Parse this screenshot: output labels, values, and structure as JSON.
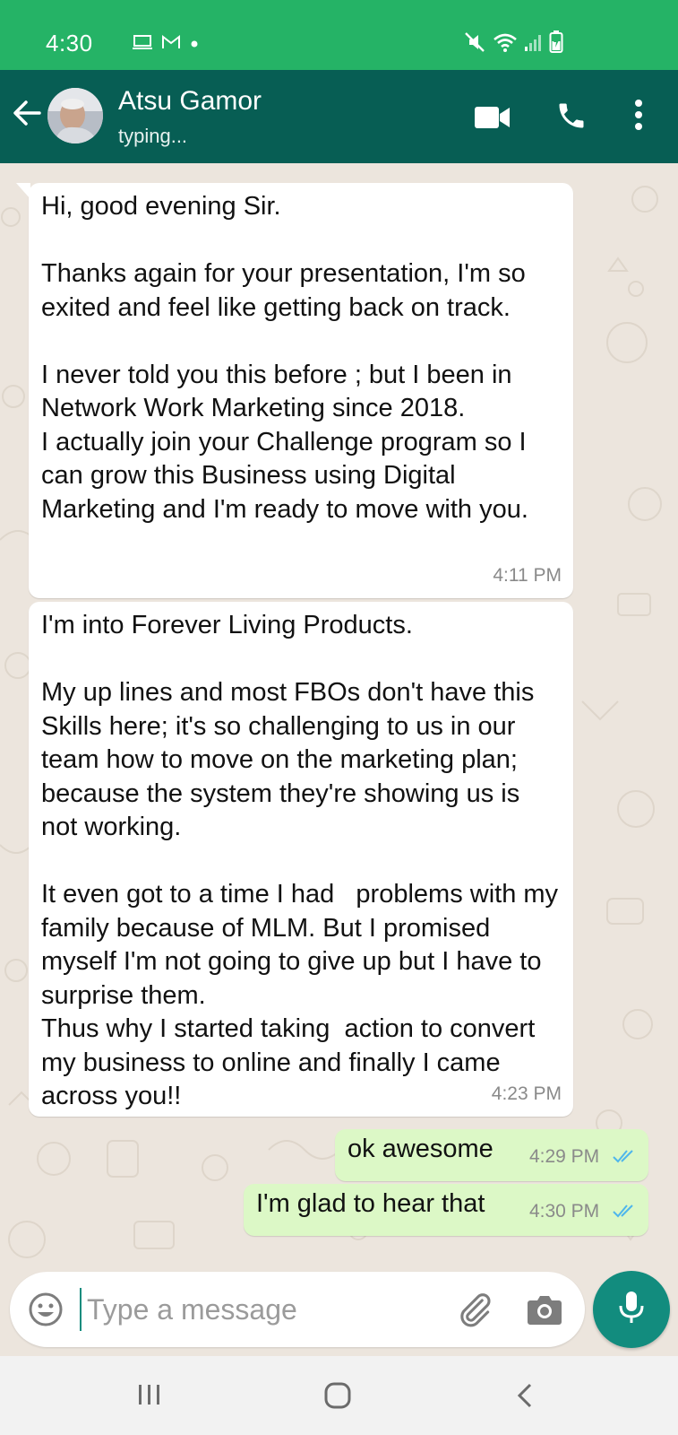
{
  "status_bar": {
    "time": "4:30",
    "icons_left": [
      "screen-icon",
      "gmail-icon",
      "dot-icon"
    ],
    "icons_right": [
      "mute-icon",
      "wifi-icon",
      "signal-icon",
      "battery-icon"
    ],
    "background_color": "#25b366"
  },
  "header": {
    "contact_name": "Atsu Gamor",
    "contact_status": "typing...",
    "background_color": "#075e54",
    "actions": [
      "video-call-icon",
      "phone-icon",
      "more-vert-icon"
    ]
  },
  "messages": [
    {
      "direction": "incoming",
      "text": "Hi, good evening Sir.\n\nThanks again for your presentation, I'm so exited and feel like getting back on track.\n\nI never told you this before ; but I been in Network Work Marketing since 2018.\nI actually join your Challenge program so I can grow this Business using Digital Marketing and I'm ready to move with you.",
      "time": "4:11 PM"
    },
    {
      "direction": "incoming",
      "text": "I'm into Forever Living Products.\n\nMy up lines and most FBOs don't have this Skills here; it's so challenging to us in our team how to move on the marketing plan; because the system they're showing us is not working.\n\nIt even got to a time I had   problems with my family because of MLM. But I promised myself I'm not going to give up but I have to surprise them.\nThus why I started taking  action to convert my business to online and finally I came across you!!",
      "time": "4:23 PM"
    },
    {
      "direction": "outgoing",
      "text": "ok awesome",
      "time": "4:29 PM",
      "status": "read"
    },
    {
      "direction": "outgoing",
      "text": "I'm glad to hear that",
      "time": "4:30 PM",
      "status": "read"
    }
  ],
  "composer": {
    "placeholder": "Type a message",
    "value": "",
    "icons": [
      "emoji-icon",
      "attach-icon",
      "camera-icon",
      "mic-icon"
    ],
    "accent_color": "#128c7e"
  },
  "navbar": {
    "buttons": [
      "recents-icon",
      "home-icon",
      "back-icon"
    ]
  },
  "colors": {
    "chat_background": "#ece5dd",
    "outgoing_bubble": "#dcf8c6",
    "incoming_bubble": "#ffffff",
    "read_ticks": "#4fb6ec"
  }
}
